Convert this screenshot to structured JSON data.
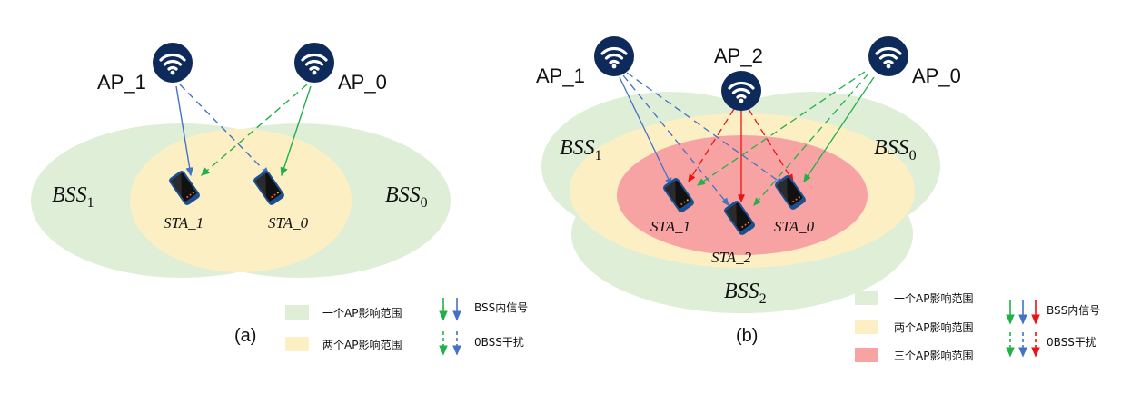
{
  "panel_a": {
    "caption": "(a)",
    "aps": {
      "ap1": "AP_1",
      "ap0": "AP_0"
    },
    "bss1": {
      "base": "BSS",
      "sub": "1"
    },
    "bss0": {
      "base": "BSS",
      "sub": "0"
    },
    "stas": {
      "sta1": "STA_1",
      "sta0": "STA_0"
    },
    "legend": {
      "one_ap": "一个AP影响范围",
      "two_ap": "两个AP影响范围",
      "intra": "BSS内信号",
      "obss": "0BSS干扰"
    }
  },
  "panel_b": {
    "caption": "(b)",
    "aps": {
      "ap1": "AP_1",
      "ap2": "AP_2",
      "ap0": "AP_0"
    },
    "bss1": {
      "base": "BSS",
      "sub": "1"
    },
    "bss0": {
      "base": "BSS",
      "sub": "0"
    },
    "bss2": {
      "base": "BSS",
      "sub": "2"
    },
    "stas": {
      "sta1": "STA_1",
      "sta2": "STA_2",
      "sta0": "STA_0"
    },
    "legend": {
      "one_ap": "一个AP影响范围",
      "two_ap": "两个AP影响范围",
      "three_ap": "三个AP影响范围",
      "intra": "BSS内信号",
      "obss": "0BSS干扰"
    }
  },
  "colors": {
    "one_ap": "#dfeed6",
    "two_ap": "#fcefc4",
    "three_ap": "#f7a3a3",
    "ap_icon": "#0d2a5a",
    "blue": "#4472c4",
    "green": "#22b04a",
    "red": "#ee1111"
  }
}
